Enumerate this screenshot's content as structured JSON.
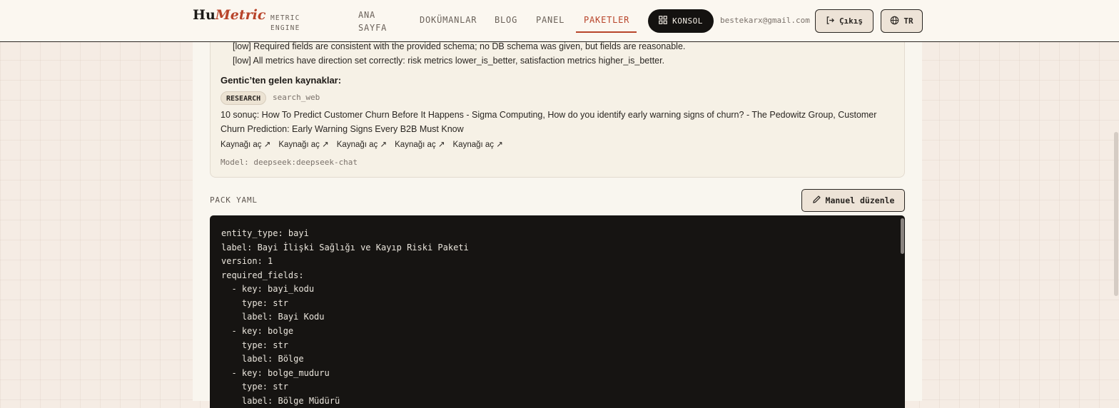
{
  "nav": {
    "logo_main": "Hu",
    "logo_accent": "Metric",
    "logo_sub_line1": "METRIC",
    "logo_sub_line2": "ENGINE",
    "home_line1": "ANA",
    "home_line2": "SAYFA",
    "docs": "DOKÜMANLAR",
    "blog": "BLOG",
    "panel": "PANEL",
    "packages": "PAKETLER",
    "console": "KONSOL",
    "email": "bestekarx@gmail.com",
    "logout": "Çıkış",
    "language": "TR",
    "accent_color": "#b8442a"
  },
  "analysis": {
    "findings": [
      "[low] Required fields are consistent with the provided schema; no DB schema was given, but fields are reasonable.",
      "[low] All metrics have direction set correctly: risk metrics lower_is_better, satisfaction metrics higher_is_better."
    ],
    "sources_title": "Gentic’ten gelen kaynaklar:",
    "tag": "RESEARCH",
    "tool": "search_web",
    "results_text": "10 sonuç: How To Predict Customer Churn Before It Happens - Sigma Computing, How do you identify early warning signs of churn? - The Pedowitz Group, Customer Churn Prediction: Early Warning Signs Every B2B Must Know",
    "source_links": [
      "Kaynağı aç ↗",
      "Kaynağı aç ↗",
      "Kaynağı aç ↗",
      "Kaynağı aç ↗",
      "Kaynağı aç ↗"
    ],
    "model": "Model: deepseek:deepseek-chat"
  },
  "yaml": {
    "label": "PACK YAML",
    "edit_button": "Manuel düzenle",
    "lines": [
      "entity_type: bayi",
      "label: Bayi İlişki Sağlığı ve Kayıp Riski Paketi",
      "version: 1",
      "required_fields:",
      "  - key: bayi_kodu",
      "    type: str",
      "    label: Bayi Kodu",
      "  - key: bolge",
      "    type: str",
      "    label: Bölge",
      "  - key: bolge_muduru",
      "    type: str",
      "    label: Bölge Müdürü"
    ]
  }
}
